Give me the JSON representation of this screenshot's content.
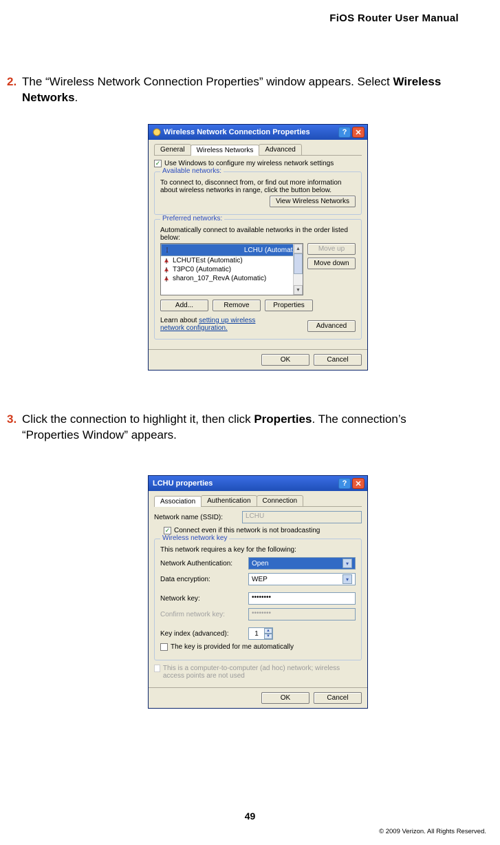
{
  "header": "FiOS Router User Manual",
  "step1": {
    "num": "2.",
    "text_a": "The “Wireless Network Connection Properties” window appears. Select ",
    "bold": "Wireless Networks",
    "text_b": "."
  },
  "step2": {
    "num": "3.",
    "text_a": "Click the connection to highlight it, then click ",
    "bold": "Properties",
    "text_b": ". The connection’s “Properties Window” appears."
  },
  "dlg1": {
    "title": "Wireless Network Connection Properties",
    "tabs": [
      "General",
      "Wireless Networks",
      "Advanced"
    ],
    "active_tab": 1,
    "use_windows": "Use Windows to configure my wireless network settings",
    "avail_title": "Available networks:",
    "avail_text": "To connect to, disconnect from, or find out more information about wireless networks in range, click the button below.",
    "view_btn": "View Wireless Networks",
    "pref_title": "Preferred networks:",
    "pref_text": "Automatically connect to available networks in the order listed below:",
    "items": [
      "LCHU (Automatic)",
      "LCHUTEst (Automatic)",
      "T3PC0 (Automatic)",
      "sharon_107_RevA (Automatic)"
    ],
    "moveup": "Move up",
    "movedown": "Move down",
    "add": "Add...",
    "remove": "Remove",
    "properties": "Properties",
    "learn1": "Learn about ",
    "learn_link": "setting up wireless network configuration.",
    "advanced": "Advanced",
    "ok": "OK",
    "cancel": "Cancel"
  },
  "dlg2": {
    "title": "LCHU properties",
    "tabs": [
      "Association",
      "Authentication",
      "Connection"
    ],
    "active_tab": 0,
    "ssid_label": "Network name (SSID):",
    "ssid_value": "LCHU",
    "connect_even": "Connect even if this network is not broadcasting",
    "wnk_title": "Wireless network key",
    "wnk_text": "This network requires a key for the following:",
    "auth_label": "Network Authentication:",
    "auth_value": "Open",
    "enc_label": "Data encryption:",
    "enc_value": "WEP",
    "key_label": "Network key:",
    "key_value": "••••••••",
    "ckey_label": "Confirm network key:",
    "ckey_value": "••••••••",
    "idx_label": "Key index (advanced):",
    "idx_value": "1",
    "auto_key": "The key is provided for me automatically",
    "adhoc": "This is a computer-to-computer (ad hoc) network; wireless access points are not used",
    "ok": "OK",
    "cancel": "Cancel"
  },
  "page_num": "49",
  "copyright": "© 2009 Verizon. All Rights Reserved."
}
